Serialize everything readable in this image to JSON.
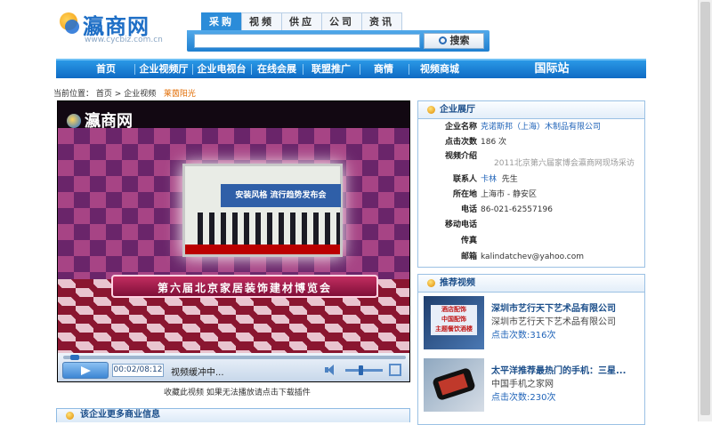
{
  "logo": {
    "name": "瀛商网",
    "domain": "www.cycbiz.com.cn"
  },
  "search": {
    "tabs": [
      "采购",
      "视频",
      "供应",
      "公司",
      "资讯"
    ],
    "active_tab": 0,
    "placeholder": "",
    "button_label": "搜索"
  },
  "nav": {
    "items": [
      "首页",
      "企业视频厅",
      "企业电视台",
      "在线会展",
      "联盟推广",
      "商情",
      "视频商城"
    ],
    "international": "国际站"
  },
  "breadcrumb": {
    "prefix": "当前位置：",
    "home": "首页",
    "sep1": ">",
    "section": "企业视频",
    "current": "莱茵阳光"
  },
  "video": {
    "watermark": "瀛商网",
    "banner": "安装风格 流行趋势发布会",
    "caption": "第六届北京家居装饰建材博览会",
    "time": "00:02/08:12",
    "status": "视频缓冲中...",
    "progress": 0.02,
    "volume": 0.4
  },
  "video_note": "收藏此视频  如果无法播放请点击下载插件",
  "more_info_title": "该企业更多商业信息",
  "company_panel": {
    "title": "企业展厅",
    "rows": [
      {
        "label": "企业名称",
        "value": "克诺斯邦（上海）木制品有限公司",
        "link": true
      },
      {
        "label": "点击次数",
        "value": "186 次",
        "link": false
      },
      {
        "label": "视频介绍",
        "value": "",
        "link": false
      },
      {
        "label": "联系人",
        "value": "卡林  先生",
        "link": false
      },
      {
        "label": "所在地",
        "value": "上海市 - 静安区",
        "link": false
      },
      {
        "label": "电话",
        "value": "86-021-62557196",
        "link": false
      },
      {
        "label": "移动电话",
        "value": "",
        "link": false
      },
      {
        "label": "传真",
        "value": "",
        "link": false
      },
      {
        "label": "邮箱",
        "value": "kalindatchev@yahoo.com",
        "link": false
      }
    ],
    "video_intro": "2011北京第六届家博会瀛商网现场采访",
    "contact_name": "卡林",
    "contact_title": "先生"
  },
  "recommend_panel": {
    "title": "推荐视频",
    "items": [
      {
        "title": "深圳市艺行天下艺术品有限公司",
        "company": "深圳市艺行天下艺术品有限公司",
        "clicks": "点击次数:316次",
        "thumb_text": "酒店配饰\n中国配饰\n主题餐饮酒楼"
      },
      {
        "title": "太平洋推荐最热门的手机：三星...",
        "company": "中国手机之家网",
        "clicks": "点击次数:230次",
        "thumb_text": ""
      }
    ]
  },
  "colors": {
    "nav_blue": "#1a7fd3",
    "link_blue": "#1f63b8",
    "accent_orange": "#e26b00"
  }
}
